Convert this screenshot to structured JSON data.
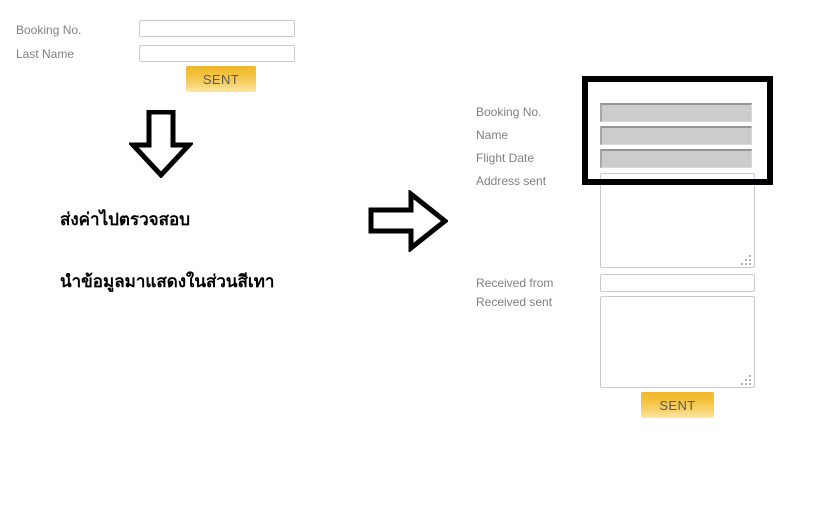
{
  "left_form": {
    "fields": [
      {
        "label": "Booking No.",
        "value": "",
        "placeholder": ""
      },
      {
        "label": "Last Name",
        "value": "",
        "placeholder": ""
      }
    ],
    "submit_label": "SENT"
  },
  "annotations": {
    "down_arrow": "down-arrow",
    "right_arrow": "right-arrow",
    "line1": "ส่งค่าไปตรวจสอบ",
    "line2": "นำข้อมูลมาแสดงในส่วนสีเทา"
  },
  "right_form": {
    "fields": [
      {
        "label": "Booking No.",
        "value": "",
        "placeholder": "",
        "type": "gray"
      },
      {
        "label": "Name",
        "value": "",
        "placeholder": "",
        "type": "gray"
      },
      {
        "label": "Flight Date",
        "value": "",
        "placeholder": "",
        "type": "gray"
      },
      {
        "label": "Address sent",
        "value": "",
        "placeholder": "",
        "type": "textarea"
      },
      {
        "label": "Received from",
        "value": "",
        "placeholder": "",
        "type": "text"
      },
      {
        "label": "Received sent",
        "value": "",
        "placeholder": "",
        "type": "textarea"
      }
    ],
    "submit_label": "SENT"
  },
  "colors": {
    "button_top": "#f0b62b",
    "button_bottom": "#fbe7a8",
    "button_text": "#595959",
    "label_text": "#808080",
    "input_border": "#c8cbd4",
    "gray_fill": "#cccccc",
    "gray_border": "#949494",
    "highlight_border": "#000000",
    "annotation_text": "#000000",
    "background": "#ffffff"
  }
}
